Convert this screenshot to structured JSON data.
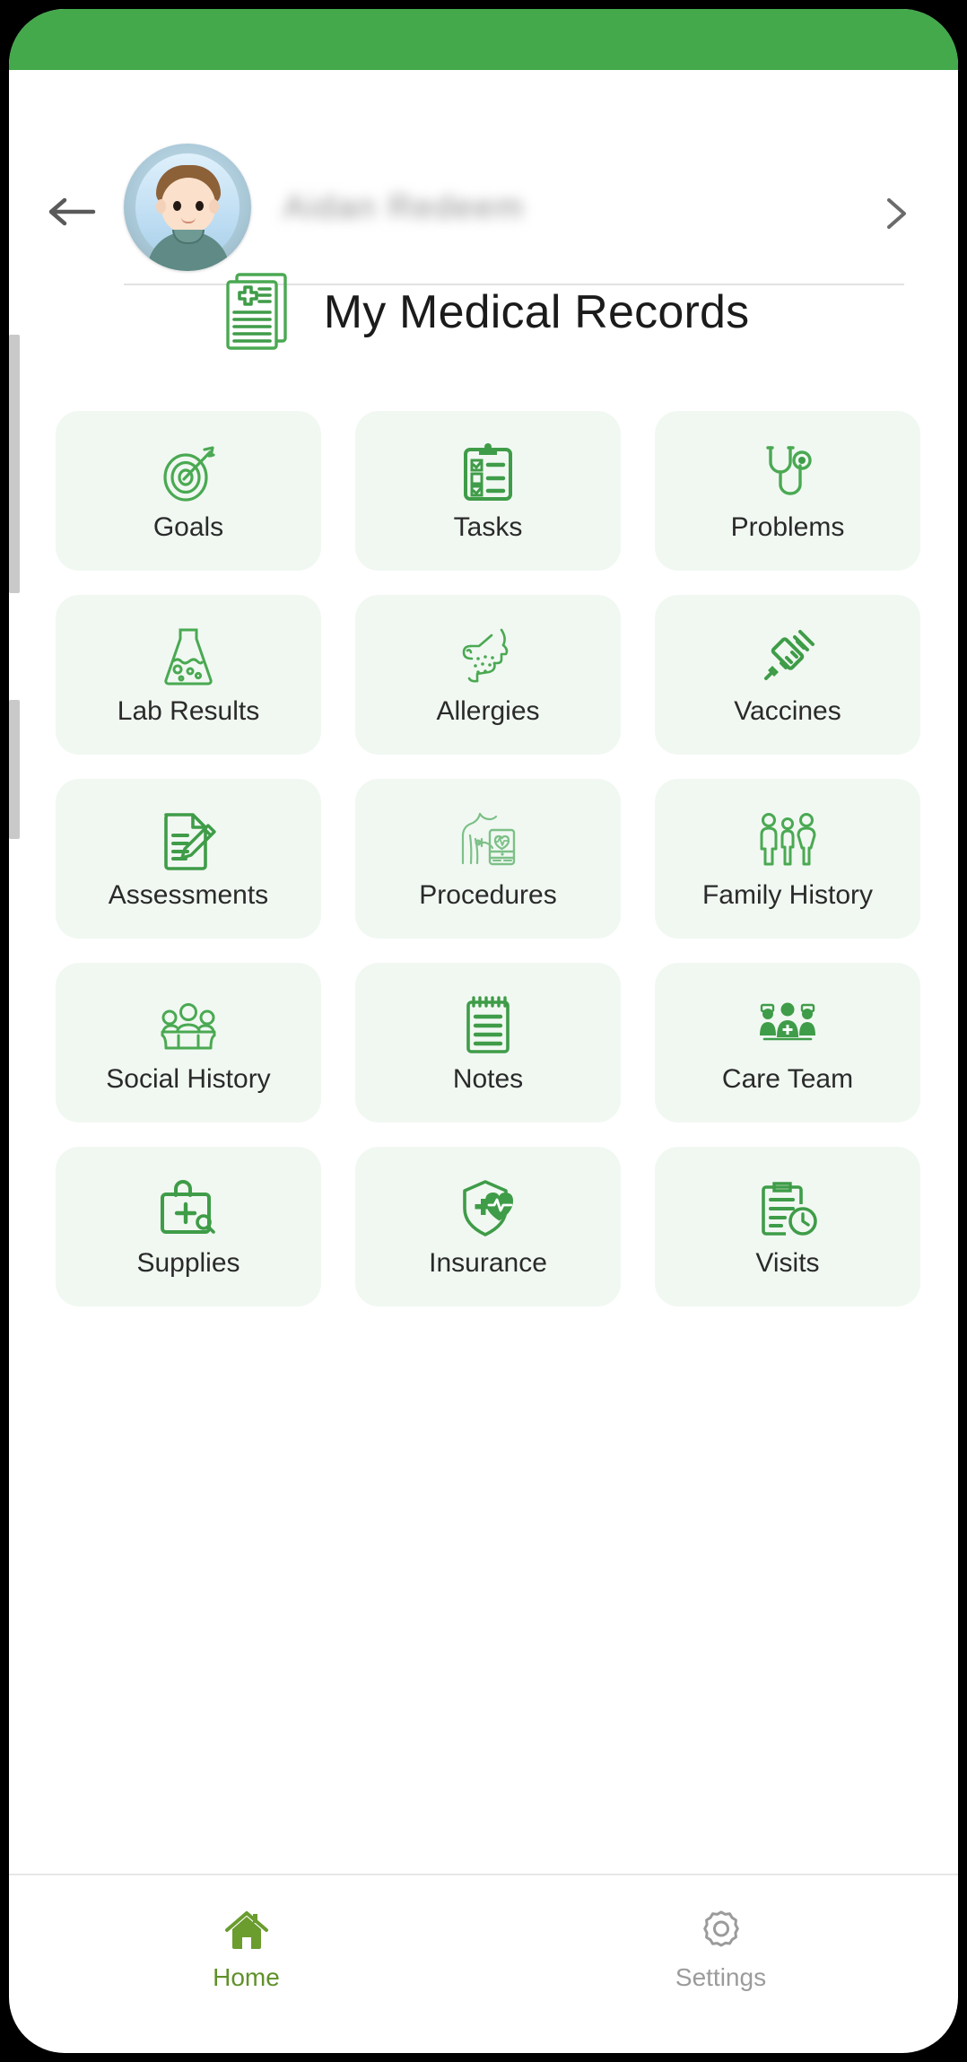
{
  "theme": {
    "status_bar_color": "#43a94b",
    "tile_bg": "#f1f8f2",
    "icon_green": "#3f9c48",
    "active_nav_color": "#5f9129",
    "inactive_nav_color": "#9b9b9b"
  },
  "header": {
    "back_icon": "back-arrow-icon",
    "avatar_icon": "patient-avatar",
    "patient_name": "Aidan Redeem",
    "forward_icon": "chevron-right-icon"
  },
  "page": {
    "title": "My Medical Records",
    "title_icon": "medical-records-icon"
  },
  "grid": {
    "tiles": [
      {
        "label": "Goals",
        "icon": "target-icon"
      },
      {
        "label": "Tasks",
        "icon": "clipboard-checklist-icon"
      },
      {
        "label": "Problems",
        "icon": "stethoscope-icon"
      },
      {
        "label": "Lab Results",
        "icon": "flask-icon"
      },
      {
        "label": "Allergies",
        "icon": "face-rash-icon"
      },
      {
        "label": "Vaccines",
        "icon": "syringe-icon"
      },
      {
        "label": "Assessments",
        "icon": "document-pencil-icon"
      },
      {
        "label": "Procedures",
        "icon": "patient-monitor-icon"
      },
      {
        "label": "Family History",
        "icon": "family-group-icon"
      },
      {
        "label": "Social History",
        "icon": "people-group-icon"
      },
      {
        "label": "Notes",
        "icon": "notepad-icon"
      },
      {
        "label": "Care Team",
        "icon": "care-team-icon"
      },
      {
        "label": "Supplies",
        "icon": "medical-bag-plus-icon"
      },
      {
        "label": "Insurance",
        "icon": "shield-heart-icon"
      },
      {
        "label": "Visits",
        "icon": "clipboard-clock-icon"
      }
    ]
  },
  "bottom_nav": {
    "items": [
      {
        "label": "Home",
        "icon": "home-icon",
        "active": true
      },
      {
        "label": "Settings",
        "icon": "gear-icon",
        "active": false
      }
    ]
  }
}
